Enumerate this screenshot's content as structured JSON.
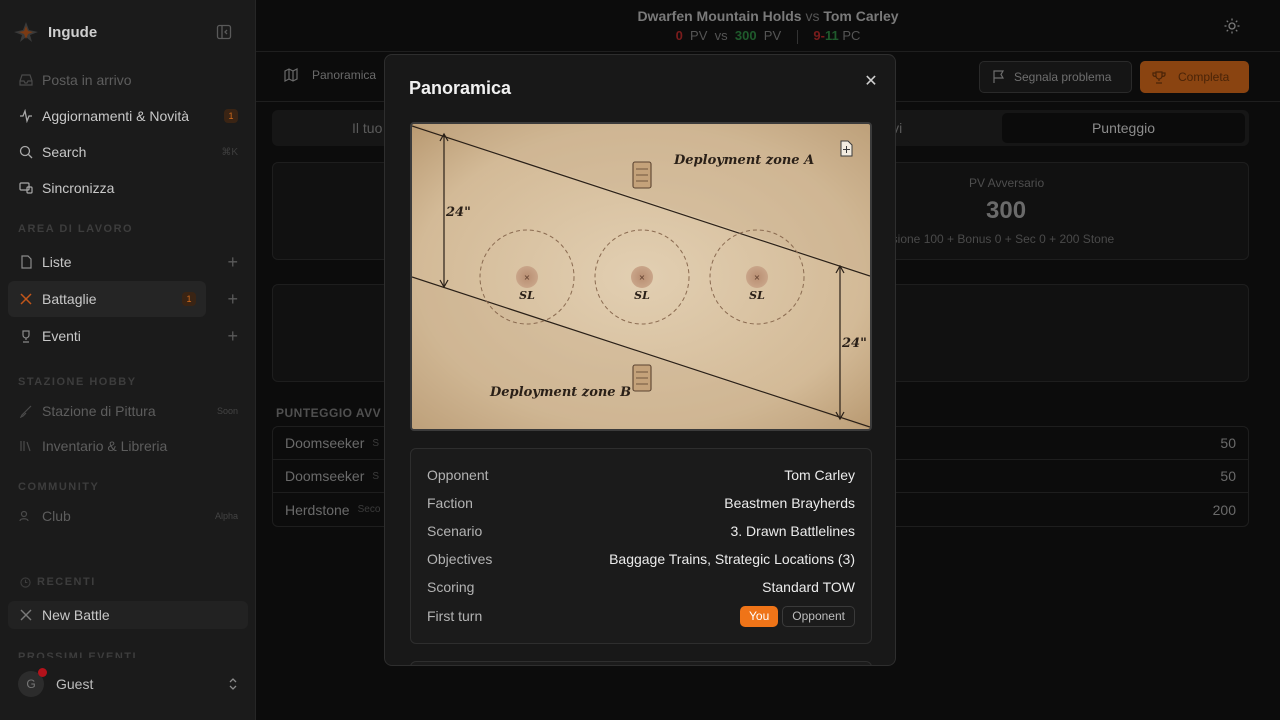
{
  "app": {
    "name": "Ingude"
  },
  "nav_top": [
    {
      "label": "Posta in arrivo",
      "icon": "inbox-icon"
    },
    {
      "label": "Aggiornamenti & Novità",
      "icon": "activity-icon",
      "badge": "1"
    },
    {
      "label": "Search",
      "icon": "search-icon",
      "shortcut": "⌘K"
    },
    {
      "label": "Sincronizza",
      "icon": "sync-icon"
    }
  ],
  "sections": {
    "workspace": "AREA DI LAVORO",
    "hobby": "STAZIONE HOBBY",
    "community": "COMMUNITY",
    "recent": "RECENTI",
    "events": "PROSSIMI EVENTI"
  },
  "workspace_items": [
    {
      "label": "Liste",
      "icon": "file-icon"
    },
    {
      "label": "Battaglie",
      "icon": "crossed-swords-icon",
      "badge": "1"
    },
    {
      "label": "Eventi",
      "icon": "trophy-icon"
    }
  ],
  "hobby_items": [
    {
      "label": "Stazione di Pittura",
      "icon": "brush-icon",
      "tag": "Soon"
    },
    {
      "label": "Inventario & Libreria",
      "icon": "library-icon"
    }
  ],
  "community_items": [
    {
      "label": "Club",
      "icon": "users-icon",
      "tag": "Alpha"
    }
  ],
  "recent_items": [
    {
      "label": "New Battle",
      "icon": "crossed-swords-icon"
    }
  ],
  "user": {
    "initial": "G",
    "name": "Guest"
  },
  "header": {
    "player": "Dwarfen Mountain Holds",
    "vs": "vs",
    "opponent": "Tom Carley",
    "my_vp": "0",
    "vp_label": "PV",
    "vs_small": "vs",
    "opp_vp": "300",
    "pc_a": "9",
    "pc_dash": "-",
    "pc_b": "11",
    "pc_label": "PC"
  },
  "toolbar": {
    "overview_label": "Panoramica",
    "report_label": "Segnala problema",
    "complete_label": "Completa"
  },
  "tabs": {
    "first_partial": "Il tuo",
    "third_partial": "ivi",
    "active": "Punteggio"
  },
  "opp_card": {
    "label": "PV Avversario",
    "value": "300",
    "breakdown": "cisione 100 + Bonus 0 + Sec 0 + 200 Stone"
  },
  "score_section": {
    "title": "PUNTEGGIO AVV",
    "rows": [
      {
        "name": "Doomseeker",
        "sub": "S",
        "points": "50"
      },
      {
        "name": "Doomseeker",
        "sub": "S",
        "points": "50"
      },
      {
        "name": "Herdstone",
        "sub": "Seco",
        "points": "200"
      }
    ]
  },
  "modal": {
    "title": "Panoramica",
    "map": {
      "zone_a": "Deployment zone A",
      "zone_b": "Deployment zone B",
      "dist_left": "24\"",
      "dist_right": "24\"",
      "objective_label": "SL",
      "parchment_color": "#d8c2a3"
    },
    "details": [
      {
        "key": "Opponent",
        "value": "Tom Carley"
      },
      {
        "key": "Faction",
        "value": "Beastmen Brayherds"
      },
      {
        "key": "Scenario",
        "value": "3. Drawn Battlelines"
      },
      {
        "key": "Objectives",
        "value": "Baggage Trains, Strategic Locations (3)"
      },
      {
        "key": "Scoring",
        "value": "Standard TOW"
      }
    ],
    "first_turn": {
      "label": "First turn",
      "you": "You",
      "opponent": "Opponent"
    }
  },
  "colors": {
    "accent": "#ef7418",
    "danger": "#b3121b"
  }
}
